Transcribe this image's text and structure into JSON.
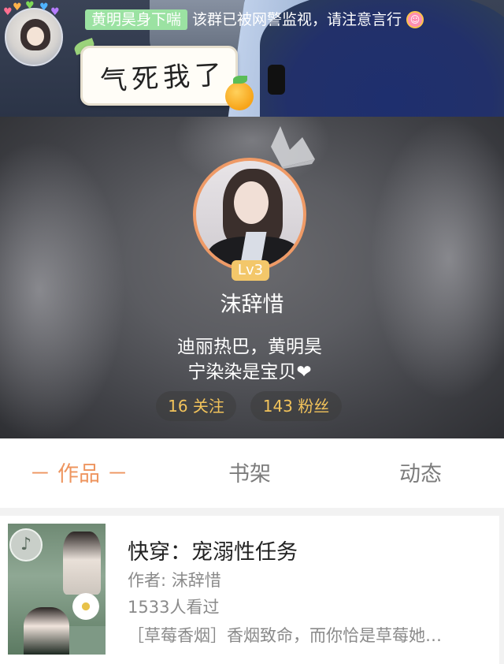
{
  "group_banner": {
    "tag_label": "黄明昊身下喘",
    "notice_text": "该群已被网警监视，请注意言行",
    "sticker_text": "气死我了",
    "hearts_colors": [
      "#ff6f91",
      "#ffb34a",
      "#7ed957",
      "#4fb3ff",
      "#b57cff"
    ]
  },
  "profile": {
    "level_badge": "Lv3",
    "nickname": "沫辞惜",
    "bio_line1": "迪丽热巴，黄明昊",
    "bio_line2": "宁染染是宝贝❤",
    "following_label": "16 关注",
    "followers_label": "143 粉丝",
    "avatar_ring_color": "#ef9a66"
  },
  "tabs": [
    {
      "label": "－ 作品 －",
      "active": true
    },
    {
      "label": "书架",
      "active": false
    },
    {
      "label": "动态",
      "active": false
    }
  ],
  "book": {
    "title": "快穿：宠溺性任务",
    "author": "作者: 沫辞惜",
    "views": "1533人看过",
    "description": "［草莓香烟］香烟致命，而你恰是草莓她…"
  },
  "theme": {
    "accent": "#ee955f",
    "stat_text": "#f2c35b",
    "tab_inactive": "#7c7c7c"
  }
}
